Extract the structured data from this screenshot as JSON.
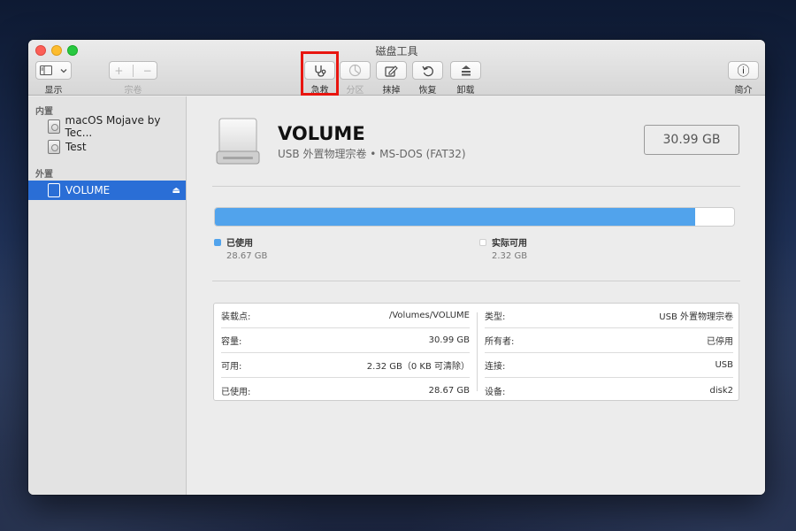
{
  "window": {
    "title": "磁盘工具"
  },
  "toolbar": {
    "display_label": "显示",
    "volume_label": "宗卷",
    "first_aid_label": "急救",
    "partition_label": "分区",
    "erase_label": "抹掉",
    "restore_label": "恢复",
    "unmount_label": "卸载",
    "info_label": "简介",
    "add_symbol": "+",
    "remove_symbol": "−",
    "info_symbol": "ⓘ"
  },
  "sidebar": {
    "internal_header": "内置",
    "external_header": "外置",
    "internal_items": [
      {
        "label": "macOS Mojave by Tec..."
      },
      {
        "label": "Test"
      }
    ],
    "external_items": [
      {
        "label": "VOLUME",
        "selected": true
      }
    ]
  },
  "volume": {
    "name": "VOLUME",
    "subtitle": "USB 外置物理宗卷 • MS-DOS (FAT32)",
    "capacity": "30.99 GB",
    "used_fraction": 0.925,
    "used_color": "#51a3ec",
    "free_color": "#ffffff"
  },
  "legend": {
    "used_label": "已使用",
    "used_value": "28.67 GB",
    "free_label": "实际可用",
    "free_value": "2.32 GB"
  },
  "info": {
    "left": [
      {
        "label": "装载点:",
        "value": "/Volumes/VOLUME"
      },
      {
        "label": "容量:",
        "value": "30.99 GB"
      },
      {
        "label": "可用:",
        "value": "2.32 GB（0 KB 可清除）"
      },
      {
        "label": "已使用:",
        "value": "28.67 GB"
      }
    ],
    "right": [
      {
        "label": "类型:",
        "value": "USB 外置物理宗卷"
      },
      {
        "label": "所有者:",
        "value": "已停用"
      },
      {
        "label": "连接:",
        "value": "USB"
      },
      {
        "label": "设备:",
        "value": "disk2"
      }
    ]
  }
}
